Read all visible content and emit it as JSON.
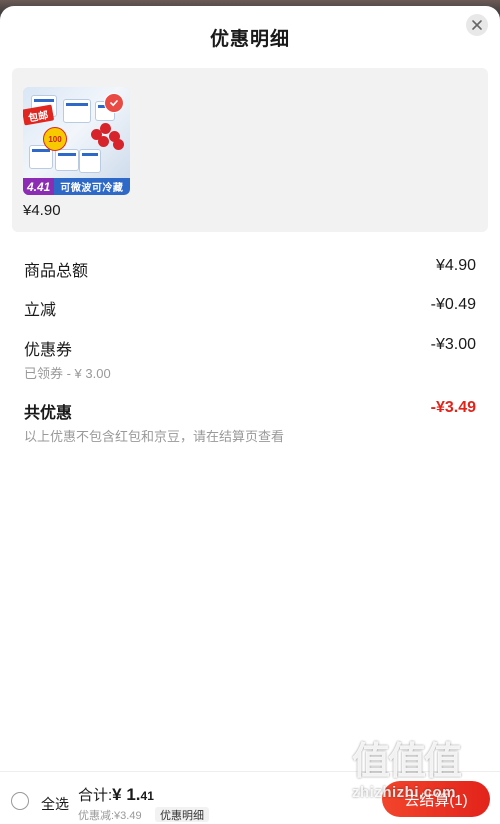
{
  "header": {
    "title": "优惠明细"
  },
  "product": {
    "price": "¥4.90",
    "thumb": {
      "tag": "包邮",
      "badge": "100",
      "flag_price": "4.41",
      "band_text": "可微波可冷藏"
    }
  },
  "summary": {
    "goods_total": {
      "label": "商品总额",
      "value": "¥4.90"
    },
    "instant_discount": {
      "label": "立减",
      "value": "-¥0.49"
    },
    "coupon": {
      "label": "优惠券",
      "value": "-¥3.00",
      "note": "已领券 - ¥ 3.00"
    },
    "total_discount": {
      "label": "共优惠",
      "value": "-¥3.49",
      "note": "以上优惠不包含红包和京豆，请在结算页查看"
    }
  },
  "footer": {
    "select_all": "全选",
    "total_label": "合计:",
    "total_int": "¥ 1.",
    "total_dec": "41",
    "discount_text": "优惠减:¥3.49",
    "detail_chip": "优惠明细",
    "checkout": "去结算(1)"
  },
  "watermark": {
    "big": "值值值",
    "small": "zhizhizhi.com"
  },
  "colors": {
    "accent_red": "#e2231a",
    "card_bg": "#f2f2f2"
  }
}
